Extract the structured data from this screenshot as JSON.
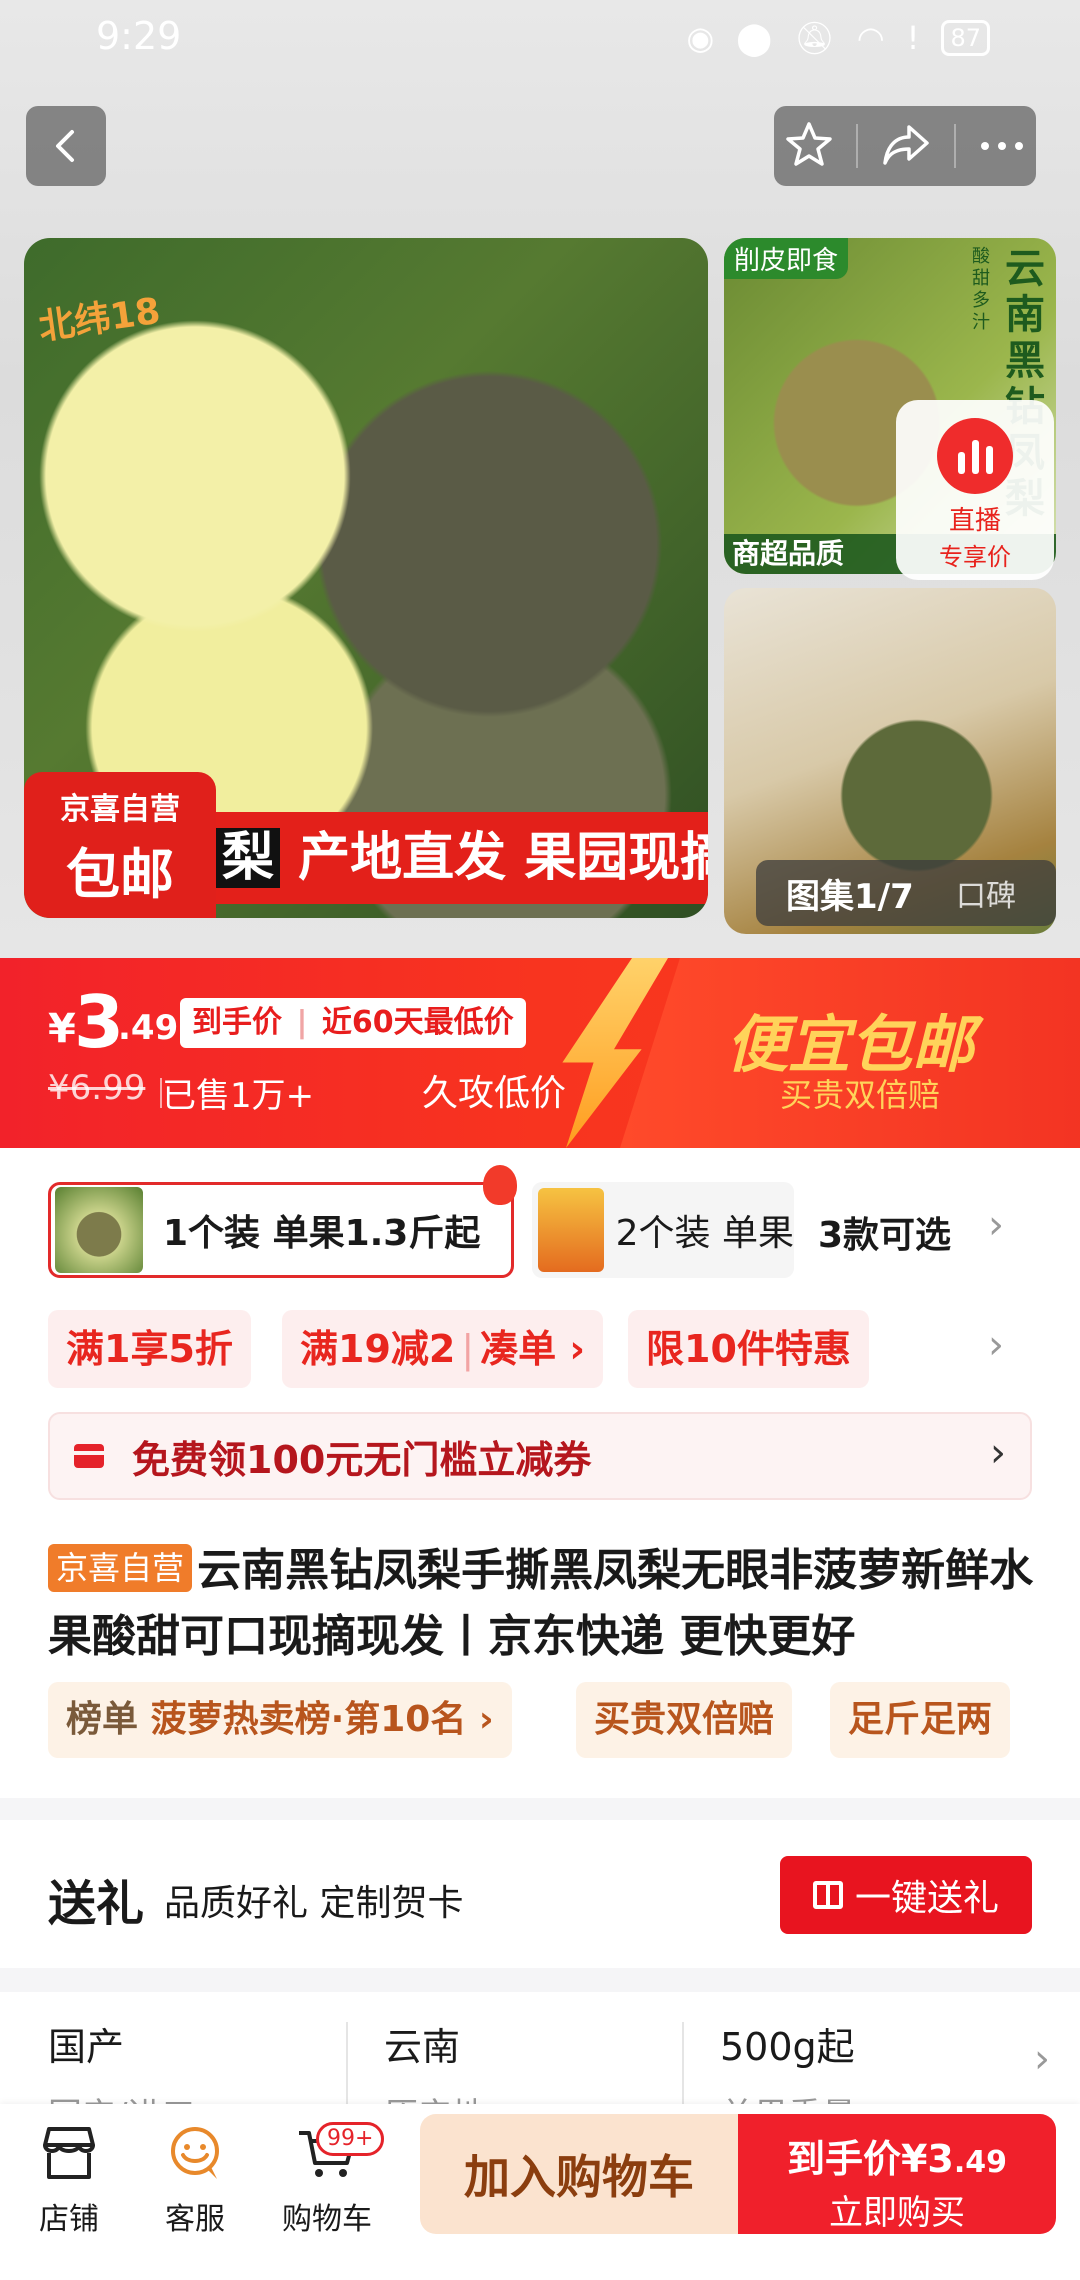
{
  "status": {
    "time": "9:29",
    "battery": "87",
    "icons": [
      "eye-icon",
      "location-icon",
      "mute-bell-icon",
      "wifi-icon",
      "alert-icon",
      "battery-icon"
    ]
  },
  "gallery": {
    "main_logo": "北纬18",
    "badge_line1": "京喜自营",
    "badge_line2": "包邮",
    "strip_lead": "梨",
    "strip_text": "产地直发 果园现摘",
    "side1_tag": "削皮即食",
    "side1_vertical": "云南黑钻凤梨",
    "side1_small": "酸甜多汁",
    "side1_bottom": "商超品质",
    "live_line1": "直播",
    "live_line2": "专享价",
    "counter": "图集1/7",
    "reviews_tab": "口碑"
  },
  "price": {
    "currency": "¥",
    "integer": "3",
    "decimal": ".49",
    "pill_left": "到手价",
    "pill_divider": "|",
    "pill_right": "近60天最低价",
    "original": "¥6.99",
    "sold": "已售1万+",
    "long_low": "久攻低价",
    "promo_main": "便宜包邮",
    "promo_sub": "买贵双倍赔"
  },
  "variants": {
    "option1": "1个装 单果1.3斤起",
    "option2": "2个装 单果",
    "more": "3款可选"
  },
  "coupons": {
    "c1": "满1享5折",
    "c2a": "满19减2",
    "c2b": "凑单 ›",
    "c3": "限10件特惠"
  },
  "voucher": {
    "text": "免费领100元无门槛立减券"
  },
  "title": {
    "badge": "京喜自营",
    "text": "云南黑钻凤梨手撕黑凤梨无眼非菠萝新鲜水果酸甜可口现摘现发丨京东快递 更快更好"
  },
  "ranks": {
    "rank_label": "榜单",
    "rank_value": "菠萝热卖榜·第10名 ›",
    "tag2": "买贵双倍赔",
    "tag3": "足斤足两"
  },
  "gift": {
    "title": "送礼",
    "subtitle": "品质好礼 定制贺卡",
    "button": "一键送礼"
  },
  "specs": {
    "s1": "国产",
    "s1_sub": "国产/进口",
    "s2": "云南",
    "s2_sub": "原产地",
    "s3": "500g起",
    "s3_sub": "单果重量"
  },
  "bottom": {
    "store": "店铺",
    "service": "客服",
    "cart": "购物车",
    "cart_badge": "99+",
    "add_cart": "加入购物车",
    "buy_price_label": "到手价",
    "buy_price_int": "¥3",
    "buy_price_dec": ".49",
    "buy_now": "立即购买"
  },
  "colors": {
    "brand_red": "#f0202b",
    "promo_gold": "#ffd35a",
    "jingxi_orange": "#f07c2a"
  }
}
